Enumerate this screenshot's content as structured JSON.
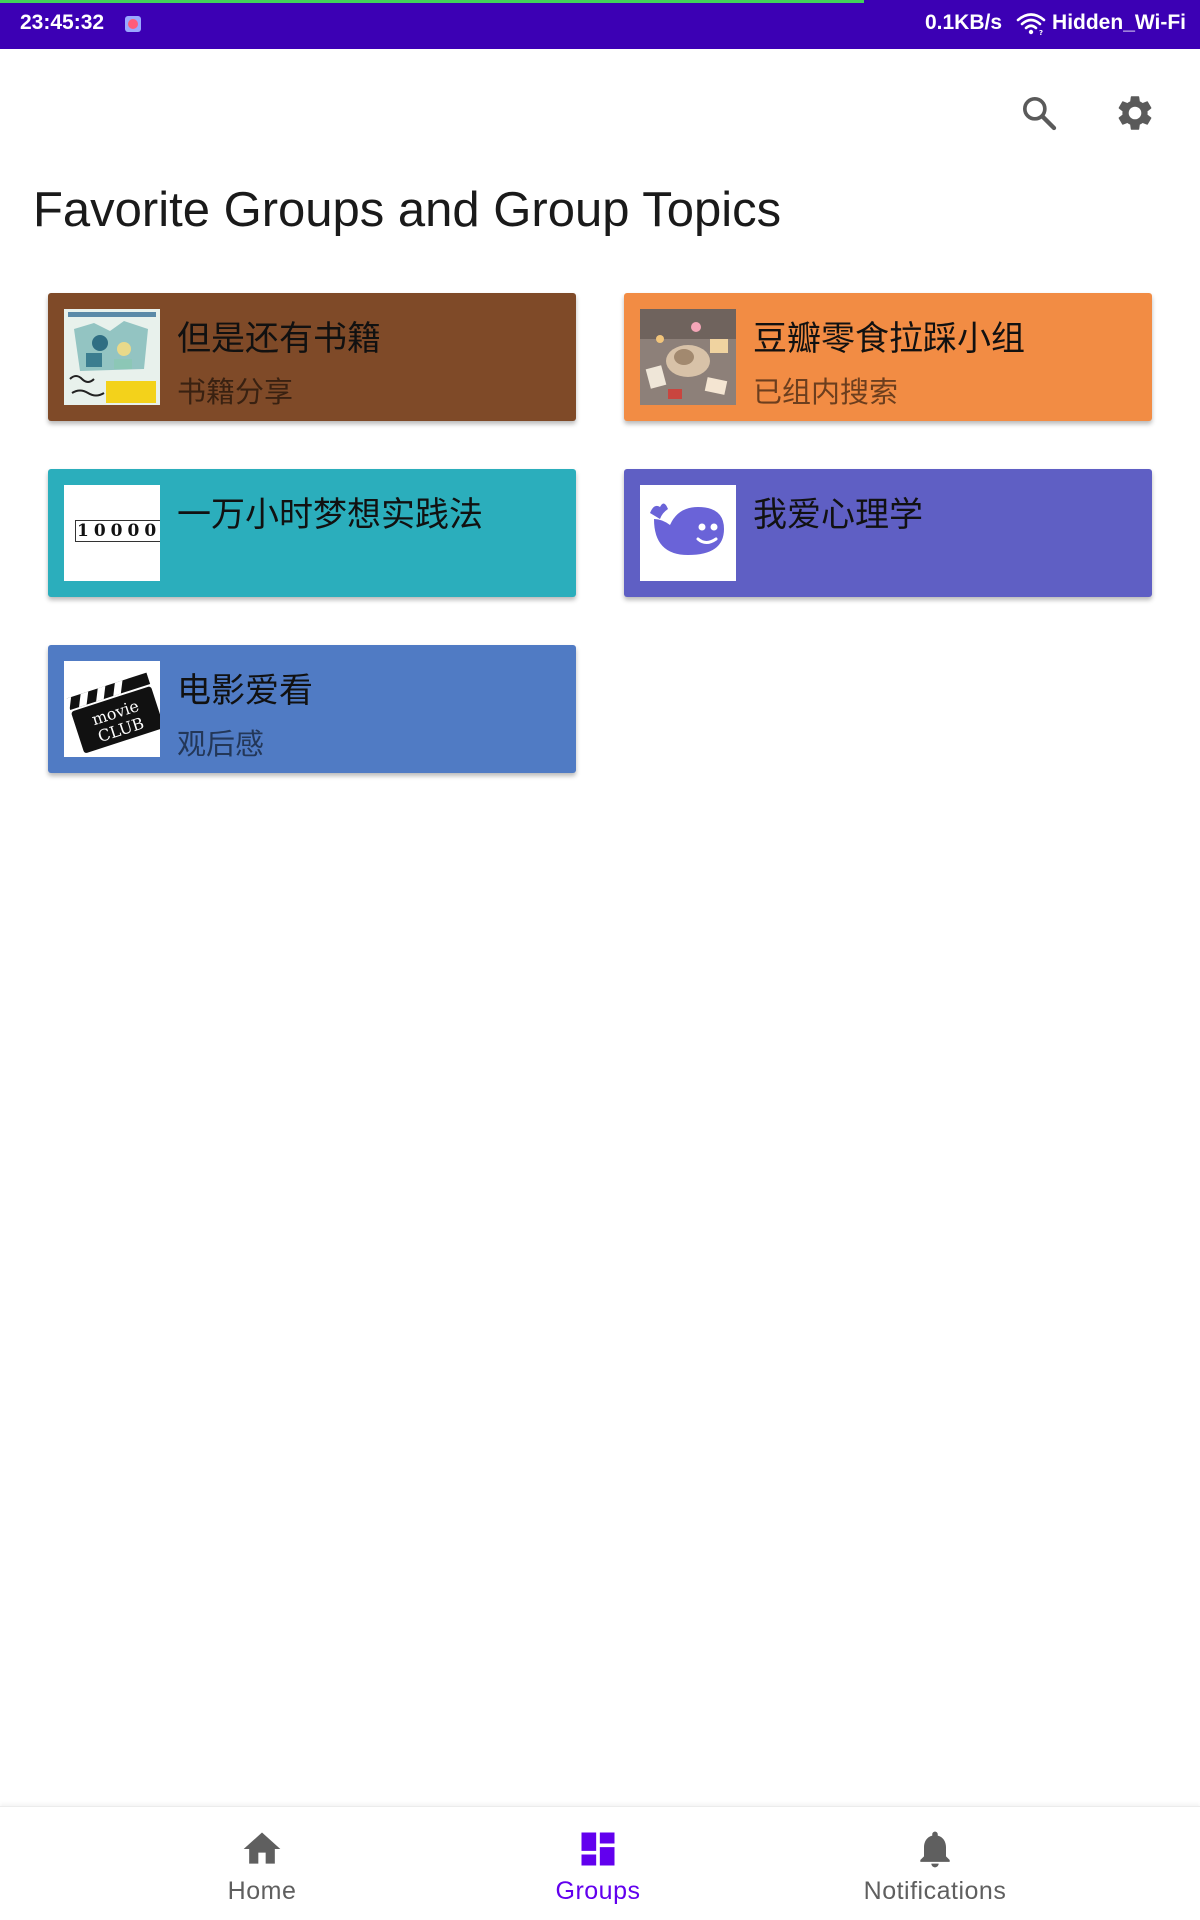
{
  "status_bar": {
    "time": "23:45:32",
    "network_speed": "0.1KB/s",
    "wifi_name": "Hidden_Wi-Fi",
    "progress_fraction": 0.72,
    "background_color": "#3c00b4"
  },
  "toolbar": {
    "search_icon": "search-icon",
    "settings_icon": "gear-icon"
  },
  "page": {
    "title": "Favorite Groups and Group Topics"
  },
  "groups": [
    {
      "name": "但是还有书籍",
      "topic": "书籍分享",
      "color": "#7f4a28",
      "thumbnail": "book-cover"
    },
    {
      "name": "豆瓣零食拉踩小组",
      "topic": "已组内搜索",
      "color": "#f28c44",
      "thumbnail": "snack-photo"
    },
    {
      "name": "一万小时梦想实践法",
      "topic": "",
      "color": "#2baebc",
      "thumbnail": "10000",
      "thumbnail_text": "10000"
    },
    {
      "name": "我爱心理学",
      "topic": "",
      "color": "#5f5fc4",
      "thumbnail": "whale-icon"
    },
    {
      "name": "电影爱看",
      "topic": "观后感",
      "color": "#507bc4",
      "thumbnail": "movie-club",
      "thumbnail_text": [
        "movie",
        "CLUB"
      ]
    }
  ],
  "bottom_nav": {
    "items": [
      {
        "label": "Home",
        "icon": "home-icon",
        "active": false
      },
      {
        "label": "Groups",
        "icon": "dashboard-icon",
        "active": true
      },
      {
        "label": "Notifications",
        "icon": "bell-icon",
        "active": false
      }
    ],
    "active_color": "#6200ee",
    "inactive_color": "#5f5f5f"
  }
}
